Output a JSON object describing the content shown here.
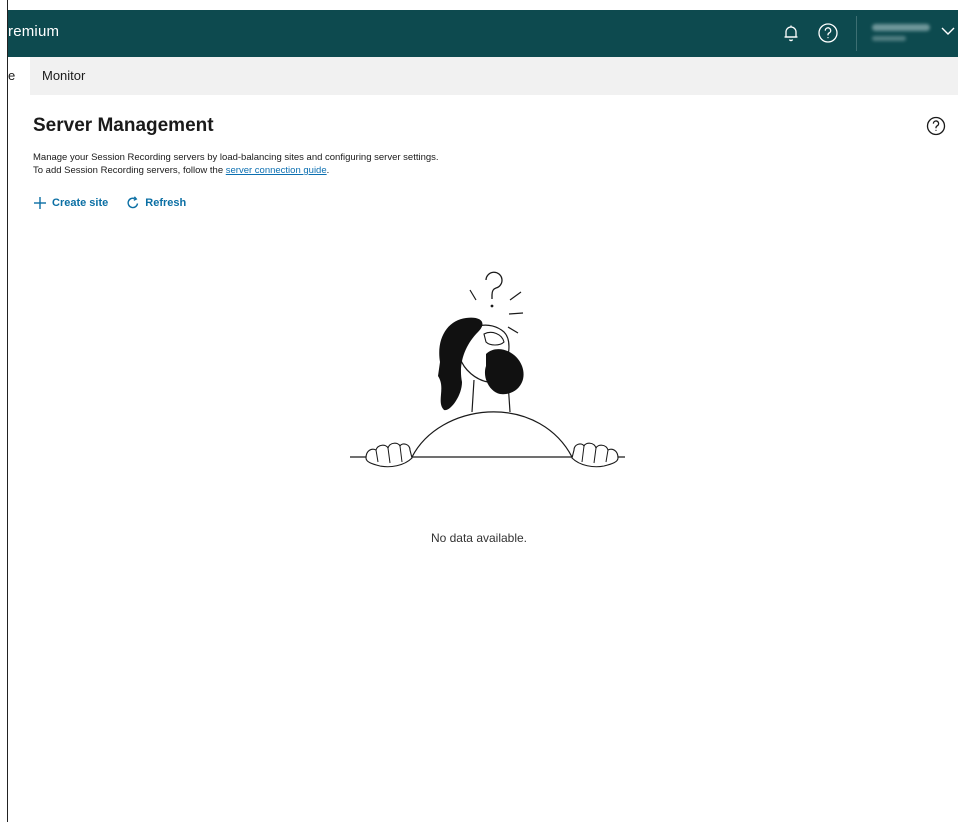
{
  "header": {
    "brand": "remium",
    "user_name": "",
    "icons": [
      "bell-icon",
      "help-circle-icon",
      "chevron-down-icon"
    ]
  },
  "tabs": {
    "partial_tab": "e",
    "monitor": "Monitor"
  },
  "page": {
    "title": "Server Management",
    "description_line1": "Manage your Session Recording servers by load-balancing sites and configuring server settings.",
    "description_line2_prefix": "To add Session Recording servers, follow the ",
    "description_link": "server connection guide",
    "description_line2_suffix": "."
  },
  "actions": {
    "create_site": "Create site",
    "refresh": "Refresh"
  },
  "empty_state": {
    "message": "No data available."
  },
  "colors": {
    "header_bg": "#0d4a4f",
    "tabbar_bg": "#f1f1f1",
    "link": "#0b6fb1",
    "action": "#0b6fa4"
  }
}
